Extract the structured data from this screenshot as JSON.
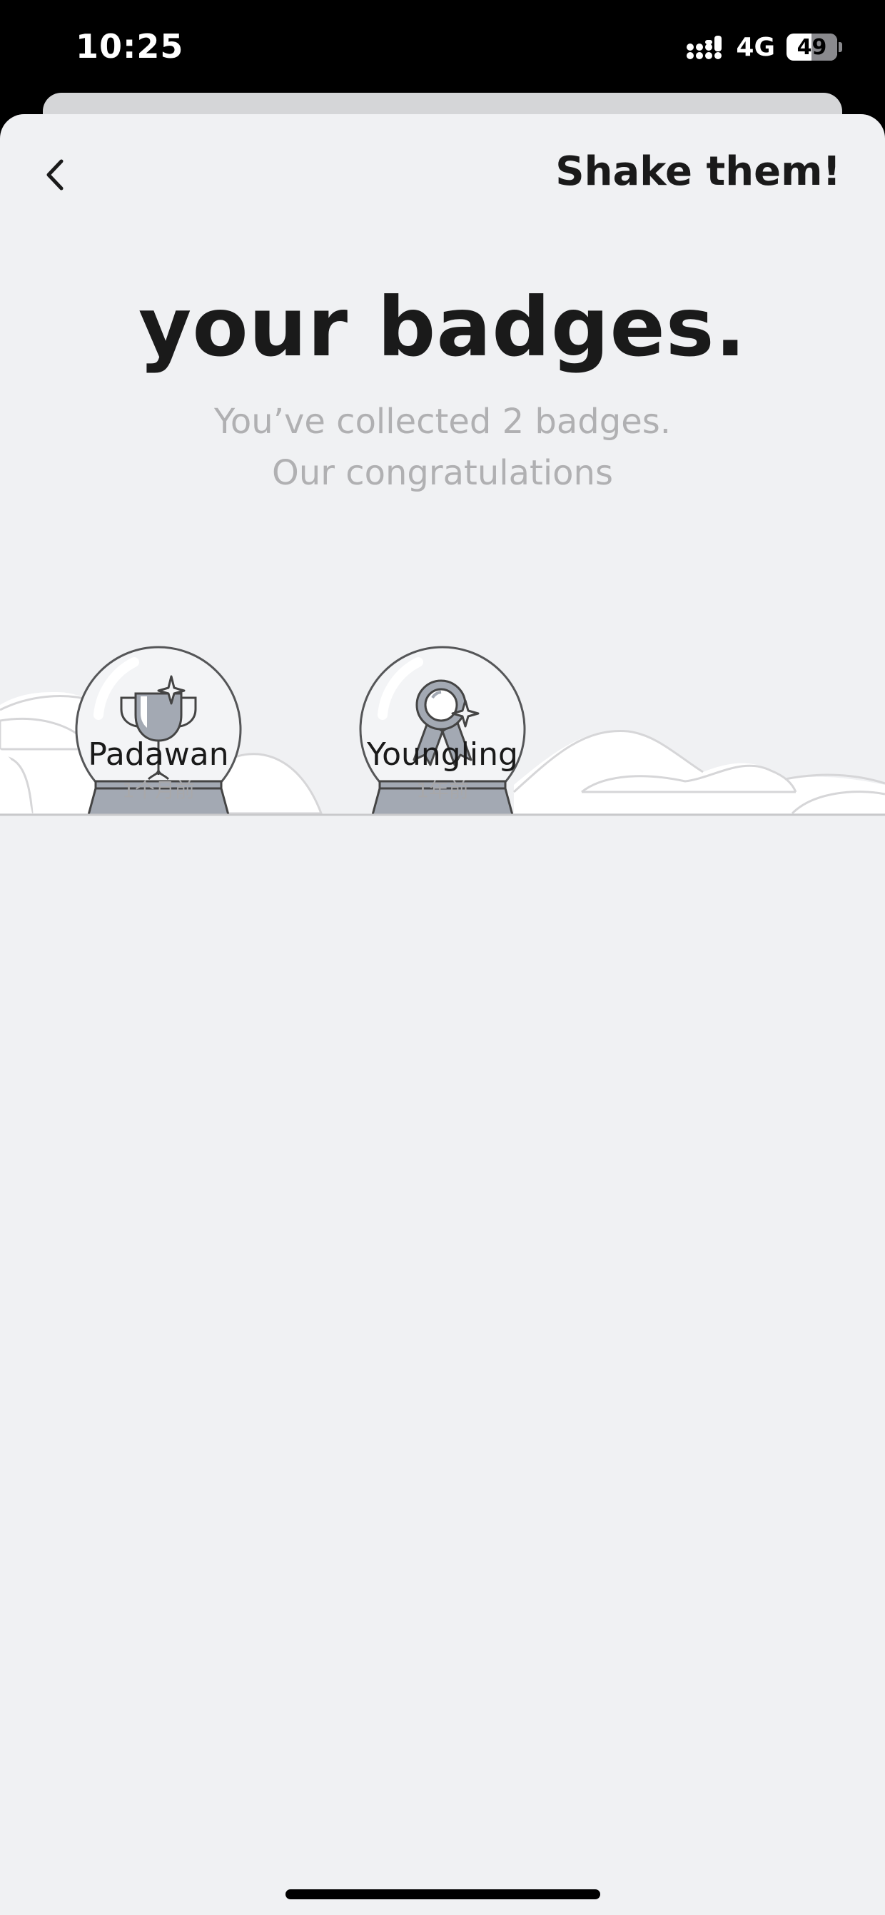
{
  "status_bar": {
    "time": "10:25",
    "network": "4G",
    "battery": "49",
    "battery_level": 0.49
  },
  "header": {
    "back_icon": "chevron-left-icon",
    "action_label": "Shake them!"
  },
  "title": "your badges.",
  "subtitle_line1": "You’ve collected 2 badges.",
  "subtitle_line2": "Our congratulations",
  "badges": [
    {
      "name": "Padawan",
      "date": "1个月前",
      "icon": "trophy-icon"
    },
    {
      "name": "Youngling",
      "date": "1年前",
      "icon": "medal-ribbon-icon"
    }
  ]
}
